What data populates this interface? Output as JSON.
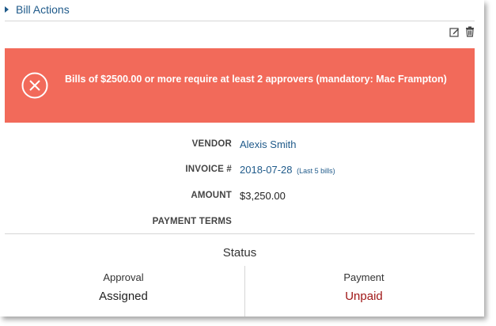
{
  "bill_actions": {
    "label": "Bill Actions"
  },
  "toolbar": {
    "edit_icon": "edit-icon",
    "delete_icon": "trash-icon"
  },
  "alert": {
    "message": "Bills of $2500.00 or more require at least 2 approvers (mandatory: Mac Frampton)",
    "icon": "close-circle-icon",
    "background": "#f26a5a"
  },
  "details": {
    "vendor_label": "VENDOR",
    "vendor_value": "Alexis Smith",
    "invoice_label": "INVOICE #",
    "invoice_value": "2018-07-28",
    "invoice_extra": "(Last 5 bills)",
    "amount_label": "AMOUNT",
    "amount_value": "$3,250.00",
    "payment_terms_label": "PAYMENT TERMS"
  },
  "status": {
    "title": "Status",
    "approval_label": "Approval",
    "approval_value": "Assigned",
    "payment_label": "Payment",
    "payment_value": "Unpaid",
    "unpaid_color": "#a01818"
  }
}
